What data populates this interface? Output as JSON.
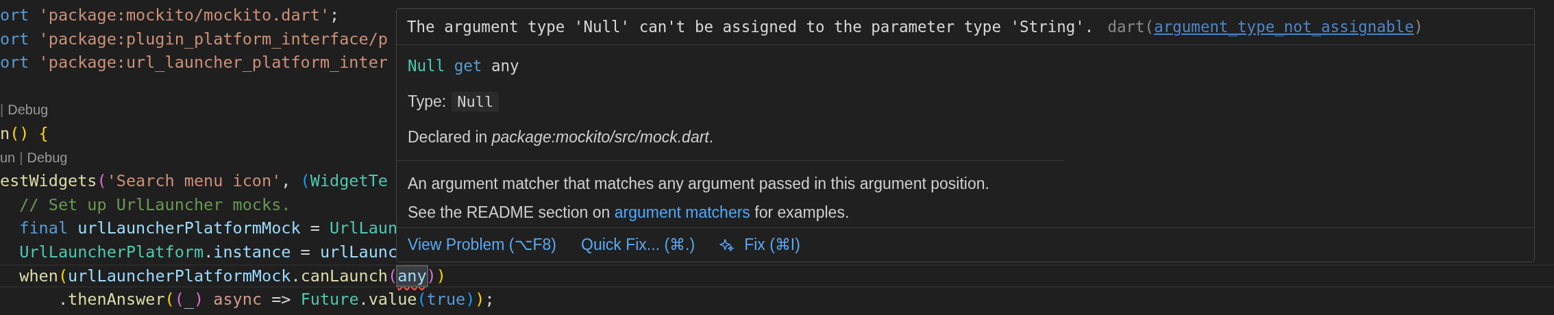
{
  "editor": {
    "lines": [
      {
        "kind": "code",
        "tokens": [
          {
            "text": "ort ",
            "kind": "keyword"
          },
          {
            "text": "'package:mockito/mockito.dart'",
            "kind": "string"
          },
          {
            "text": ";",
            "kind": "plain"
          }
        ]
      },
      {
        "kind": "code",
        "tokens": [
          {
            "text": "ort ",
            "kind": "keyword"
          },
          {
            "text": "'package:plugin_platform_interface/p",
            "kind": "string"
          }
        ]
      },
      {
        "kind": "code",
        "tokens": [
          {
            "text": "ort ",
            "kind": "keyword"
          },
          {
            "text": "'package:url_launcher_platform_inter",
            "kind": "string"
          }
        ]
      },
      {
        "kind": "blank"
      },
      {
        "kind": "lens",
        "tokens": [
          {
            "text": "|",
            "kind": "separator"
          },
          {
            "text": "Debug",
            "kind": "lens"
          }
        ]
      },
      {
        "kind": "code",
        "tokens": [
          {
            "text": "n",
            "kind": "function"
          },
          {
            "text": "() ",
            "kind": "bracket1"
          },
          {
            "text": "{",
            "kind": "bracket1"
          }
        ]
      },
      {
        "kind": "lens",
        "tokens": [
          {
            "text": "un",
            "kind": "lens"
          },
          {
            "text": "|",
            "kind": "separator"
          },
          {
            "text": "Debug",
            "kind": "lens"
          }
        ]
      },
      {
        "kind": "code",
        "tokens": [
          {
            "text": "estWidgets",
            "kind": "function"
          },
          {
            "text": "(",
            "kind": "bracket2"
          },
          {
            "text": "'Search menu icon'",
            "kind": "string"
          },
          {
            "text": ", ",
            "kind": "plain"
          },
          {
            "text": "(",
            "kind": "bracket3"
          },
          {
            "text": "WidgetTe",
            "kind": "type"
          }
        ]
      },
      {
        "kind": "code",
        "tokens": [
          {
            "text": "  // Set up UrlLauncher mocks.",
            "kind": "comment"
          }
        ]
      },
      {
        "kind": "code",
        "tokens": [
          {
            "text": "  final ",
            "kind": "keyword"
          },
          {
            "text": "urlLauncherPlatformMock",
            "kind": "variable"
          },
          {
            "text": " = ",
            "kind": "plain"
          },
          {
            "text": "UrlLaun",
            "kind": "type"
          }
        ]
      },
      {
        "kind": "code",
        "tokens": [
          {
            "text": "  UrlLauncherPlatform",
            "kind": "type"
          },
          {
            "text": ".",
            "kind": "plain"
          },
          {
            "text": "instance",
            "kind": "variable"
          },
          {
            "text": " = ",
            "kind": "plain"
          },
          {
            "text": "urlLaunc",
            "kind": "variable"
          }
        ]
      },
      {
        "kind": "current",
        "tokens": [
          {
            "text": "  when",
            "kind": "function"
          },
          {
            "text": "(",
            "kind": "bracket1"
          },
          {
            "text": "urlLauncherPlatformMock",
            "kind": "variable"
          },
          {
            "text": ".",
            "kind": "plain"
          },
          {
            "text": "canLaunch",
            "kind": "function"
          },
          {
            "text": "(",
            "kind": "bracket2"
          },
          {
            "text": "any",
            "kind": "error"
          },
          {
            "text": ")",
            "kind": "bracket2"
          },
          {
            "text": ")",
            "kind": "bracket1"
          }
        ]
      },
      {
        "kind": "code",
        "tokens": [
          {
            "text": "      .",
            "kind": "plain"
          },
          {
            "text": "thenAnswer",
            "kind": "function"
          },
          {
            "text": "(",
            "kind": "bracket1"
          },
          {
            "text": "(",
            "kind": "bracket2"
          },
          {
            "text": "_",
            "kind": "variable"
          },
          {
            "text": ") ",
            "kind": "bracket2"
          },
          {
            "text": "async",
            "kind": "modifier"
          },
          {
            "text": " => ",
            "kind": "plain"
          },
          {
            "text": "Future",
            "kind": "type"
          },
          {
            "text": ".",
            "kind": "plain"
          },
          {
            "text": "value",
            "kind": "function"
          },
          {
            "text": "(",
            "kind": "bracket3"
          },
          {
            "text": "true",
            "kind": "keyword"
          },
          {
            "text": ")",
            "kind": "bracket3"
          },
          {
            "text": ")",
            "kind": "bracket1"
          },
          {
            "text": ";",
            "kind": "plain"
          }
        ]
      }
    ]
  },
  "hover": {
    "problem": {
      "message": "The argument type 'Null' can't be assigned to the parameter type 'String'.",
      "source_prefix": "dart(",
      "code": "argument_type_not_assignable",
      "source_suffix": ")"
    },
    "signature": [
      {
        "text": "Null ",
        "kind": "type"
      },
      {
        "text": "get",
        "kind": "keyword"
      },
      {
        "text": " any",
        "kind": "plain"
      }
    ],
    "type_label": "Type:",
    "type_value": "Null",
    "declared": "Declared in *package:mockito/src/mock.dart*.",
    "description": "An argument matcher that matches any argument passed in this argument position.",
    "readme": {
      "before": "See the README section on ",
      "link": "argument matchers",
      "after": " for examples."
    },
    "actions": [
      {
        "label": "View Problem (⌥F8)",
        "kind": "plain"
      },
      {
        "label": "Quick Fix... (⌘.)",
        "kind": "plain"
      },
      {
        "label": "Fix (⌘I)",
        "kind": "ai"
      }
    ]
  }
}
